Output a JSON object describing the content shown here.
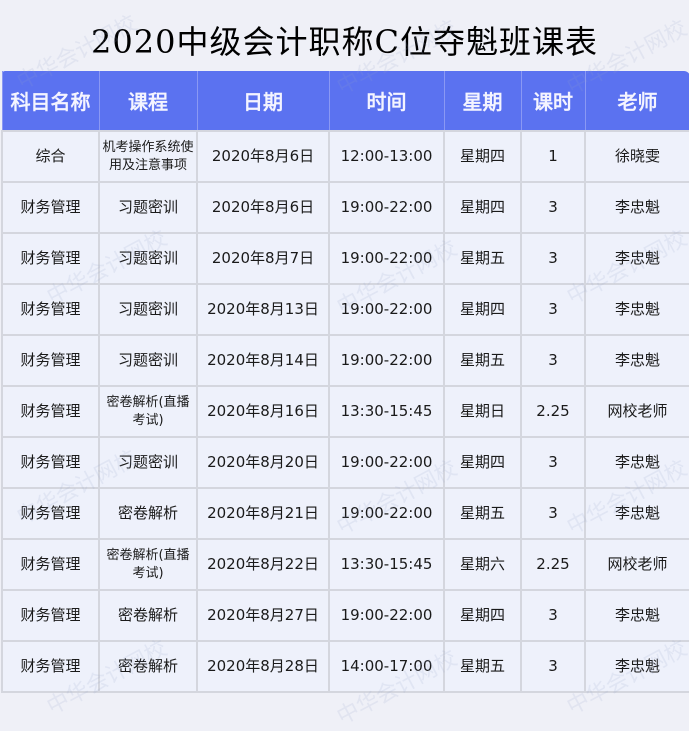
{
  "title": "2020中级会计职称C位夺魁班课表",
  "watermark": "中华会计网校",
  "columns": [
    "科目名称",
    "课程",
    "日期",
    "时间",
    "星期",
    "课时",
    "老师"
  ],
  "rows": [
    {
      "subject": "综合",
      "course": "机考操作系统使用及注意事项",
      "date": "2020年8月6日",
      "time": "12:00-13:00",
      "weekday": "星期四",
      "hours": "1",
      "teacher": "徐晓雯"
    },
    {
      "subject": "财务管理",
      "course": "习题密训",
      "date": "2020年8月6日",
      "time": "19:00-22:00",
      "weekday": "星期四",
      "hours": "3",
      "teacher": "李忠魁"
    },
    {
      "subject": "财务管理",
      "course": "习题密训",
      "date": "2020年8月7日",
      "time": "19:00-22:00",
      "weekday": "星期五",
      "hours": "3",
      "teacher": "李忠魁"
    },
    {
      "subject": "财务管理",
      "course": "习题密训",
      "date": "2020年8月13日",
      "time": "19:00-22:00",
      "weekday": "星期四",
      "hours": "3",
      "teacher": "李忠魁"
    },
    {
      "subject": "财务管理",
      "course": "习题密训",
      "date": "2020年8月14日",
      "time": "19:00-22:00",
      "weekday": "星期五",
      "hours": "3",
      "teacher": "李忠魁"
    },
    {
      "subject": "财务管理",
      "course": "密卷解析(直播考试)",
      "date": "2020年8月16日",
      "time": "13:30-15:45",
      "weekday": "星期日",
      "hours": "2.25",
      "teacher": "网校老师"
    },
    {
      "subject": "财务管理",
      "course": "习题密训",
      "date": "2020年8月20日",
      "time": "19:00-22:00",
      "weekday": "星期四",
      "hours": "3",
      "teacher": "李忠魁"
    },
    {
      "subject": "财务管理",
      "course": "密卷解析",
      "date": "2020年8月21日",
      "time": "19:00-22:00",
      "weekday": "星期五",
      "hours": "3",
      "teacher": "李忠魁"
    },
    {
      "subject": "财务管理",
      "course": "密卷解析(直播考试)",
      "date": "2020年8月22日",
      "time": "13:30-15:45",
      "weekday": "星期六",
      "hours": "2.25",
      "teacher": "网校老师"
    },
    {
      "subject": "财务管理",
      "course": "密卷解析",
      "date": "2020年8月27日",
      "time": "19:00-22:00",
      "weekday": "星期四",
      "hours": "3",
      "teacher": "李忠魁"
    },
    {
      "subject": "财务管理",
      "course": "密卷解析",
      "date": "2020年8月28日",
      "time": "14:00-17:00",
      "weekday": "星期五",
      "hours": "3",
      "teacher": "李忠魁"
    }
  ]
}
